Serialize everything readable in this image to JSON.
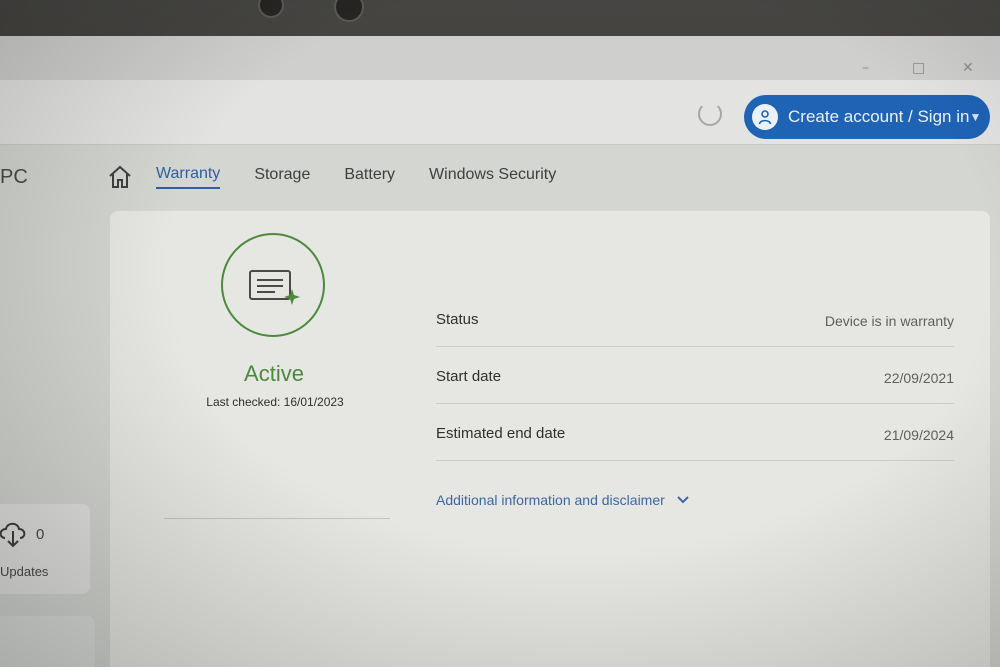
{
  "window": {
    "controls": {
      "minimize": "–",
      "maximize": "□",
      "close": "✕"
    }
  },
  "header": {
    "account_button_label": "Create account / Sign in",
    "refresh_icon": "refresh-icon",
    "avatar_icon": "person-icon"
  },
  "sidebar": {
    "title_fragment": "PC",
    "updates_count": "0",
    "updates_label": "Updates"
  },
  "nav": {
    "home_icon": "home-icon",
    "tabs": [
      {
        "label": "Warranty",
        "active": true
      },
      {
        "label": "Storage",
        "active": false
      },
      {
        "label": "Battery",
        "active": false
      },
      {
        "label": "Windows Security",
        "active": false
      }
    ]
  },
  "warranty": {
    "status_word": "Active",
    "last_checked": "Last checked: 16/01/2023",
    "rows": [
      {
        "label": "Status",
        "value": "Device is in warranty"
      },
      {
        "label": "Start date",
        "value": "22/09/2021"
      },
      {
        "label": "Estimated end date",
        "value": "21/09/2024"
      }
    ],
    "disclaimer_link": "Additional information and disclaimer"
  },
  "colors": {
    "accent_blue": "#1f63b5",
    "active_green": "#4b8a3c",
    "link_blue": "#3d66a5",
    "panel_bg": "#e6e7e3"
  }
}
